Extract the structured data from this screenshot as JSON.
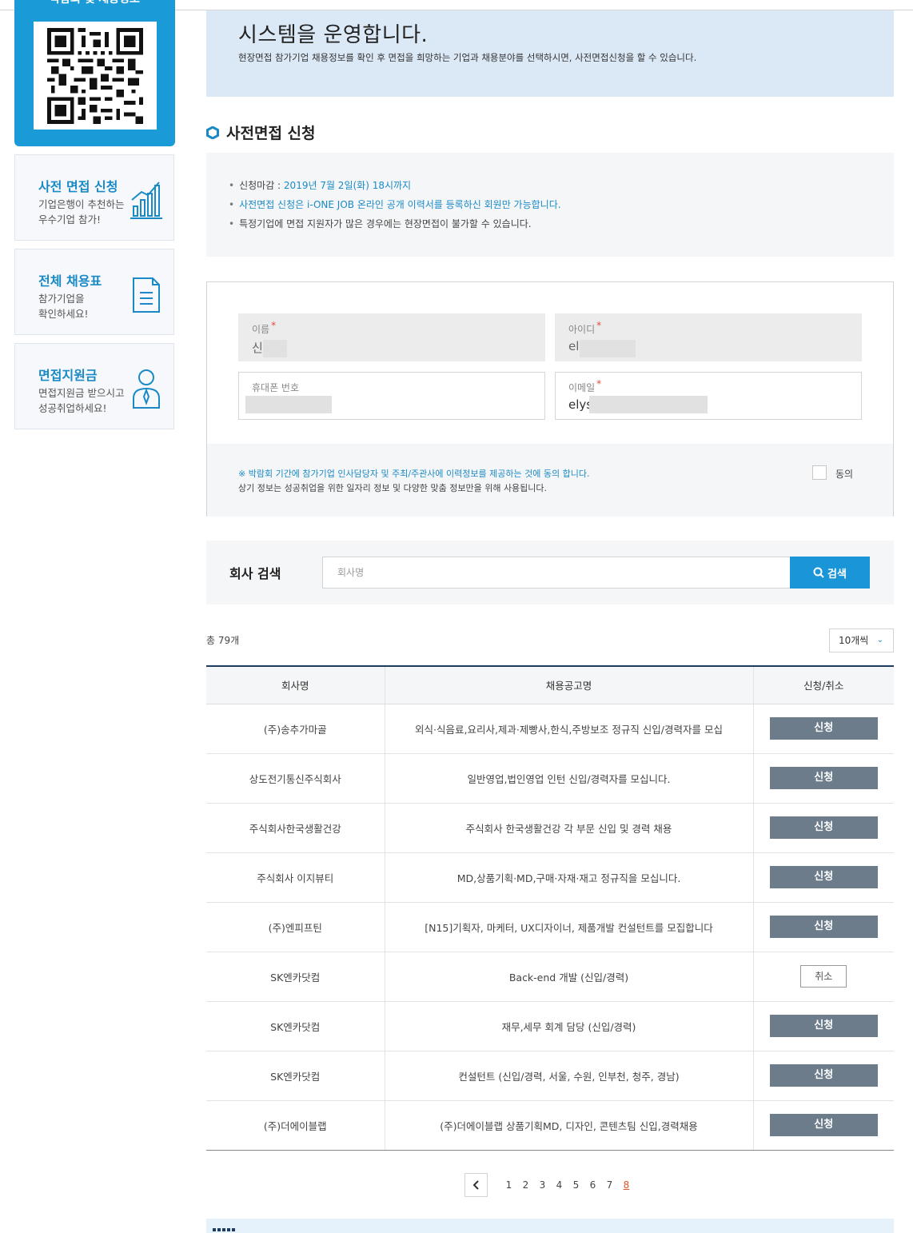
{
  "sidebar": {
    "qr_title": "박람회 및 채용정보",
    "cards": [
      {
        "title": "사전 면접 신청",
        "desc": "기업은행이 추천하는\n우수기업 참가!",
        "icon": "bar-chart-icon"
      },
      {
        "title": "전체 채용표",
        "desc": "참가기업을\n확인하세요!",
        "icon": "document-icon"
      },
      {
        "title": "면접지원금",
        "desc": "면접지원금 받으시고\n성공취업하세요!",
        "icon": "person-icon"
      }
    ]
  },
  "banner": {
    "title": "시스템을 운영합니다.",
    "subtitle": "현장면접 참가기업 채용정보를 확인 후 면접을 희망하는 기업과 채용분야를 선택하시면, 사전면접신청을 할 수 있습니다."
  },
  "section": {
    "title": "사전면접 신청"
  },
  "notice": {
    "deadline_label": "신청마감 : ",
    "deadline_value": "2019년 7월 2일(화) 18시까지",
    "line2": "사전면접 신청은 i-ONE JOB 온라인 공개 이력서를 등록하신 회원만 가능합니다.",
    "line3": "특정기업에 면접 지원자가 많은 경우에는 현장면접이 불가할 수 있습니다."
  },
  "form": {
    "name_label": "이름",
    "name_value": "신",
    "id_label": "아이디",
    "id_value": "el",
    "phone_label": "휴대폰 번호",
    "email_label": "이메일",
    "email_value": "elys",
    "required_mark": "*",
    "consent_line1": "※ 박람회 기간에 참가기업 인사담당자 및 주최/주관사에 이력정보를 제공하는 것에 동의 합니다.",
    "consent_line2": "상기 정보는 성공취업을 위한 일자리 정보 및 다양한 맞춤 정보만을 위해 사용됩니다.",
    "agree_label": "동의"
  },
  "search": {
    "label": "회사 검색",
    "placeholder": "회사명",
    "button": "검색"
  },
  "list": {
    "total": "총 79개",
    "per_page": "10개씩",
    "columns": [
      "회사명",
      "채용공고명",
      "신청/취소"
    ],
    "rows": [
      {
        "company": "(주)송추가마골",
        "title": "외식·식음료,요리사,제과·제빵사,한식,주방보조 정규직 신입/경력자를 모십",
        "action": "신청"
      },
      {
        "company": "상도전기통신주식회사",
        "title": "일반영업,법인영업 인턴 신입/경력자를 모십니다.",
        "action": "신청"
      },
      {
        "company": "주식회사한국생활건강",
        "title": "주식회사 한국생활건강 각 부문 신입 및 경력 채용",
        "action": "신청"
      },
      {
        "company": "주식회사 이지뷰티",
        "title": "MD,상품기획·MD,구매·자재·재고 정규직을 모십니다.",
        "action": "신청"
      },
      {
        "company": "(주)엔피프틴",
        "title": "[N15]기획자, 마케터, UX디자이너, 제품개발 컨설턴트를 모집합니다",
        "action": "신청"
      },
      {
        "company": "SK엔카닷컴",
        "title": "Back-end 개발 (신입/경력)",
        "action": "취소"
      },
      {
        "company": "SK엔카닷컴",
        "title": "재무,세무 회계 담당 (신입/경력)",
        "action": "신청"
      },
      {
        "company": "SK엔카닷컴",
        "title": "컨설턴트 (신입/경력, 서울, 수원, 인부천, 청주, 경남)",
        "action": "신청"
      },
      {
        "company": "(주)더에이블랩",
        "title": "(주)더에이블랩 상품기획MD, 디자인, 콘텐츠팀 신입,경력채용",
        "action": "신청"
      }
    ]
  },
  "pager": {
    "pages": [
      "1",
      "2",
      "3",
      "4",
      "5",
      "6",
      "7",
      "8"
    ],
    "current": "8"
  },
  "colors": {
    "accent": "#1a96d8",
    "navy": "#1e3c5e",
    "button_gray": "#6d7c8b",
    "current_page": "#e0532b"
  }
}
